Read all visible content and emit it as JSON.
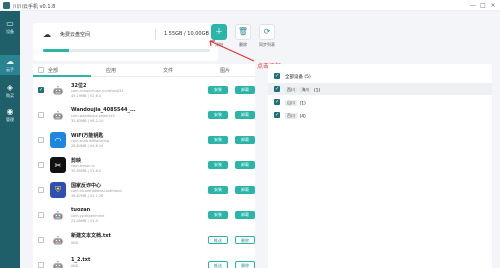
{
  "app": {
    "title": "川川云手机 v0.1.8"
  },
  "window_controls": {
    "minimize": "—",
    "maximize": "□",
    "close": "×"
  },
  "sidebar": {
    "items": [
      {
        "label": "设备",
        "icon": "▭"
      },
      {
        "label": "云手",
        "icon": "☁"
      },
      {
        "label": "购买",
        "icon": "◈"
      },
      {
        "label": "管理",
        "icon": "◉"
      }
    ]
  },
  "storage": {
    "title": "免费云盘空间",
    "size_text": "1.55GB / 10.00GB",
    "used_fraction": 0.155
  },
  "toolbar": {
    "add_label": "添加",
    "delete_label": "删除",
    "sync_label": "同步列表"
  },
  "callout": {
    "text": "点击添加"
  },
  "tabs": {
    "all": "全部",
    "apps": "应用",
    "files": "文件",
    "images": "图片"
  },
  "files": [
    {
      "name": "32位2",
      "sub": "com.chuanchuan.yunshouji32",
      "meta": "45.19MB  |  V2.6.4",
      "icon": "android",
      "checked": true,
      "action1": "安装",
      "action2": "卸载"
    },
    {
      "name": "Wandoujia_4085544_...",
      "sub": "com.wandoujia.phoenix2",
      "meta": "35.83MB  |  V8.2.10",
      "icon": "android",
      "checked": false,
      "action1": "安装",
      "action2": "卸载"
    },
    {
      "name": "WiFi万能钥匙",
      "sub": "com.snda.wifilocating",
      "meta": "28.84MB  |  V4.6.19",
      "icon": "wifi",
      "checked": false,
      "action1": "安装",
      "action2": "卸载"
    },
    {
      "name": "剪映",
      "sub": "com.lemon.lv",
      "meta": "30.90MB  |  V1.8.0",
      "icon": "capcut",
      "checked": false,
      "action1": "安装",
      "action2": "卸载"
    },
    {
      "name": "国家反诈中心",
      "sub": "com.hicorenational.antifraud",
      "meta": "36.87MB  |  V1.1.28",
      "icon": "antifraud",
      "checked": false,
      "action1": "安装",
      "action2": "卸载"
    },
    {
      "name": "tuozan",
      "sub": "com.yy.experiment",
      "meta": "22.45MB  |  V1.0",
      "icon": "android",
      "checked": false,
      "action1": "安装",
      "action2": "卸载"
    },
    {
      "name": "新建文本文档.txt",
      "sub": "",
      "meta": "0KB",
      "icon": "android",
      "checked": false,
      "action1": "推送",
      "action2": "删除"
    },
    {
      "name": "1_2.txt",
      "sub": "",
      "meta": "0KB",
      "icon": "android",
      "checked": false,
      "action1": "推送",
      "action2": "删除"
    }
  ],
  "devices": {
    "all_label": "全部设备 (5)",
    "rows": [
      {
        "tags": [
          "西川",
          "海川"
        ],
        "count": "(1)",
        "checked": true
      },
      {
        "tags": [
          "山川"
        ],
        "count": "(1)",
        "checked": true
      },
      {
        "tags": [
          "百川"
        ],
        "count": "(4)",
        "checked": true
      }
    ]
  },
  "colors": {
    "accent": "#2ab5a8",
    "sidebar": "#1e5f69",
    "callout": "#e23434"
  }
}
